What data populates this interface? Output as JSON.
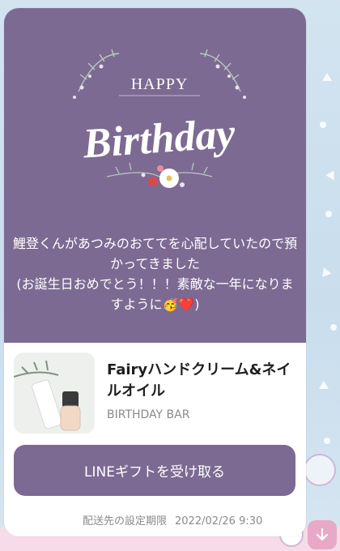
{
  "banner": {
    "happy": "HAPPY",
    "birthday": "Birthday"
  },
  "message": {
    "text": "鯉登くんがあつみのおててを心配していたので預かってきました\n(お誕生日おめでとう！！！素敵な一年になりますように🥳❤️)"
  },
  "product": {
    "title": "Fairyハンドクリーム&ネイルオイル",
    "store": "BIRTHDAY BAR"
  },
  "gift_button": {
    "label": "LINEギフトを受け取る"
  },
  "deadline": {
    "label": "配送先の設定期限",
    "datetime": "2022/02/26 9:30"
  },
  "icons": {
    "scroll_down": "arrow-down-icon"
  },
  "colors": {
    "accent": "#7d6a93",
    "chat_background": "#cfe1ee",
    "scroll_button": "#e7a9c6"
  }
}
